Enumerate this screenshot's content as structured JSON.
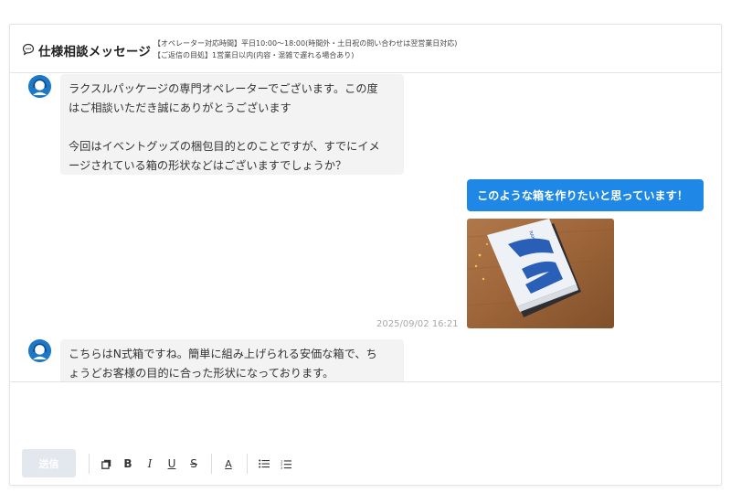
{
  "header": {
    "title": "仕様相談メッセージ",
    "info_line1": "【オペレーター対応時間】平日10:00〜18:00(時間外・土日祝の問い合わせは翌営業日対応)",
    "info_line2": "【ご返信の目処】1営業日以内(内容・混雑で遅れる場合あり)"
  },
  "messages": [
    {
      "sender": "operator",
      "paragraphs": [
        "ラクスルパッケージの専門オペレーターでございます。この度",
        "はご相談いただき誠にありがとうございます",
        "",
        "今回はイベントグッズの梱包目的とのことですが、すでにイメ",
        "ージされている箱の形状などはございますでしょうか？"
      ]
    },
    {
      "sender": "user",
      "text": "このような箱を作りたいと思っています！",
      "timestamp": "2025/09/02 16:21"
    },
    {
      "sender": "operator",
      "paragraphs": [
        "こちらはN式箱ですね。簡単に組み上げられる安価な箱で、ち",
        "ょうどお客様の目的に合った形状になっております。"
      ]
    }
  ],
  "composer": {
    "placeholder": "",
    "send_label": "送信"
  },
  "toolbar": {
    "bold": "B",
    "italic": "I",
    "underline": "U",
    "strike": "S",
    "font_color": "A"
  },
  "colors": {
    "accent": "#1f87e5",
    "operator_bubble": "#f3f3f3",
    "send_disabled": "#e3e7ee",
    "avatar": "#1e78c8"
  }
}
